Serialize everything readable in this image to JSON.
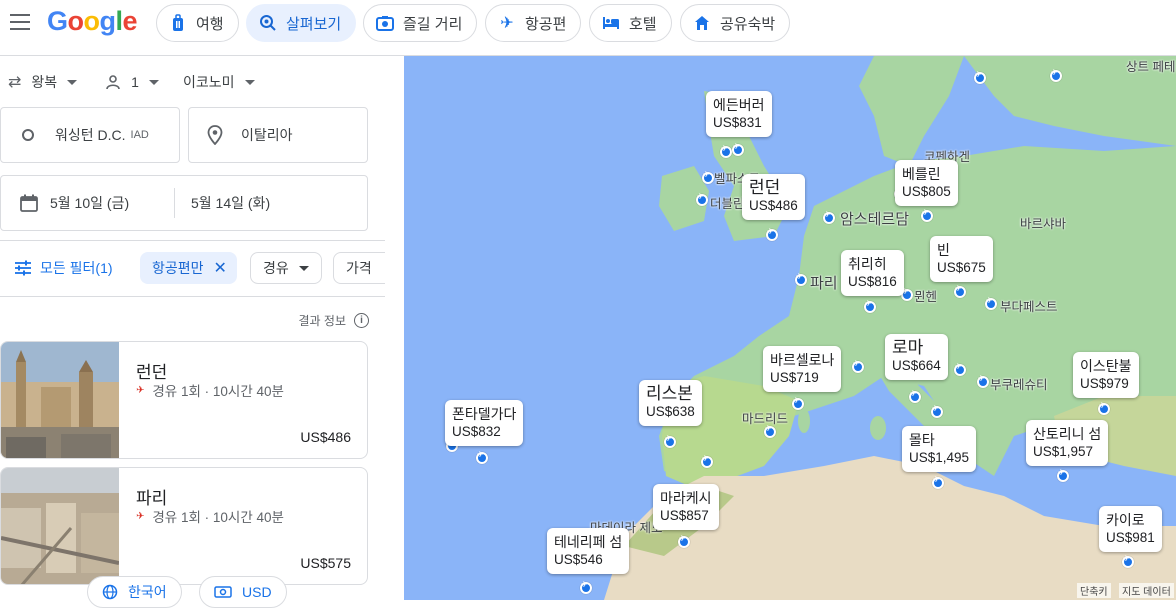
{
  "header": {
    "logo": "Google",
    "tabs": [
      {
        "label": "여행",
        "icon": "luggage-icon"
      },
      {
        "label": "살펴보기",
        "icon": "explore-icon",
        "active": true
      },
      {
        "label": "즐길 거리",
        "icon": "camera-icon"
      },
      {
        "label": "항공편",
        "icon": "airplane-icon"
      },
      {
        "label": "호텔",
        "icon": "bed-icon"
      },
      {
        "label": "공유숙박",
        "icon": "house-icon"
      }
    ]
  },
  "search": {
    "trip_type": "왕복",
    "passengers": "1",
    "cabin": "이코노미",
    "origin": "워싱턴 D.C.",
    "origin_code": "IAD",
    "destination": "이탈리아",
    "depart_date": "5월 10일 (금)",
    "return_date": "5월 14일 (화)"
  },
  "filters": {
    "all_filters": "모든 필터(1)",
    "flights_only": "항공편만",
    "stops": "경유",
    "price": "가격"
  },
  "results_info": "결과 정보",
  "results": [
    {
      "city": "런던",
      "route": "경유 1회 · 10시간 40분",
      "price": "US$486"
    },
    {
      "city": "파리",
      "route": "경유 1회 · 10시간 40분",
      "price": "US$575"
    }
  ],
  "footer": {
    "language": "한국어",
    "currency": "USD"
  },
  "map": {
    "pins": [
      {
        "city": "에든버러",
        "price": "US$831"
      },
      {
        "city": "런던",
        "price": "US$486"
      },
      {
        "city": "베를린",
        "price": "US$805"
      },
      {
        "city": "빈",
        "price": "US$675"
      },
      {
        "city": "취리히",
        "price": "US$816"
      },
      {
        "city": "로마",
        "price": "US$664"
      },
      {
        "city": "바르셀로나",
        "price": "US$719"
      },
      {
        "city": "리스본",
        "price": "US$638"
      },
      {
        "city": "폰타델가다",
        "price": "US$832"
      },
      {
        "city": "이스탄불",
        "price": "US$979"
      },
      {
        "city": "몰타",
        "price": "US$1,495"
      },
      {
        "city": "산토리니 섬",
        "price": "US$1,957"
      },
      {
        "city": "마라케시",
        "price": "US$857"
      },
      {
        "city": "테네리페 섬",
        "price": "US$546"
      },
      {
        "city": "카이로",
        "price": "US$981"
      }
    ],
    "labels": [
      "상트 페테",
      "코펜하겐",
      "벨파스트",
      "더블린",
      "암스테르담",
      "바르샤바",
      "파리",
      "뮌헨",
      "부다페스트",
      "마드리드",
      "부쿠레슈티",
      "마데이라 제도"
    ],
    "attribution": [
      "단축키",
      "지도 데이터"
    ]
  }
}
